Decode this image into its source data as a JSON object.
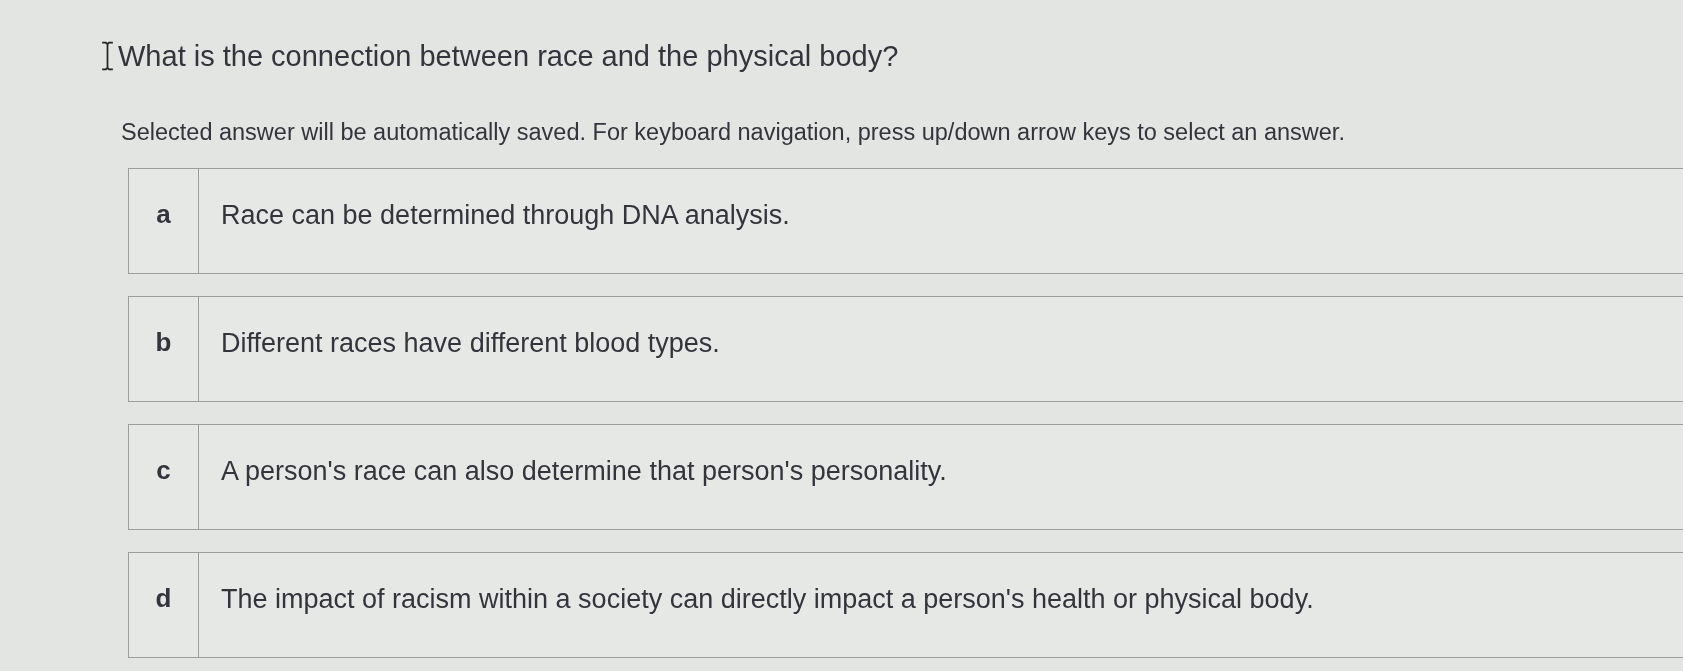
{
  "question": {
    "title": "What is the connection between race and the physical body?",
    "instructions": "Selected answer will be automatically saved. For keyboard navigation, press up/down arrow keys to select an answer."
  },
  "answers": [
    {
      "letter": "a",
      "text": "Race can be determined through DNA analysis.",
      "selected": false
    },
    {
      "letter": "b",
      "text": "Different races have different blood types.",
      "selected": false
    },
    {
      "letter": "c",
      "text": "A person's race can also determine that person's personality.",
      "selected": false
    },
    {
      "letter": "d",
      "text": "The impact of racism within a society can directly impact a person's health or physical body.",
      "selected": false
    }
  ]
}
